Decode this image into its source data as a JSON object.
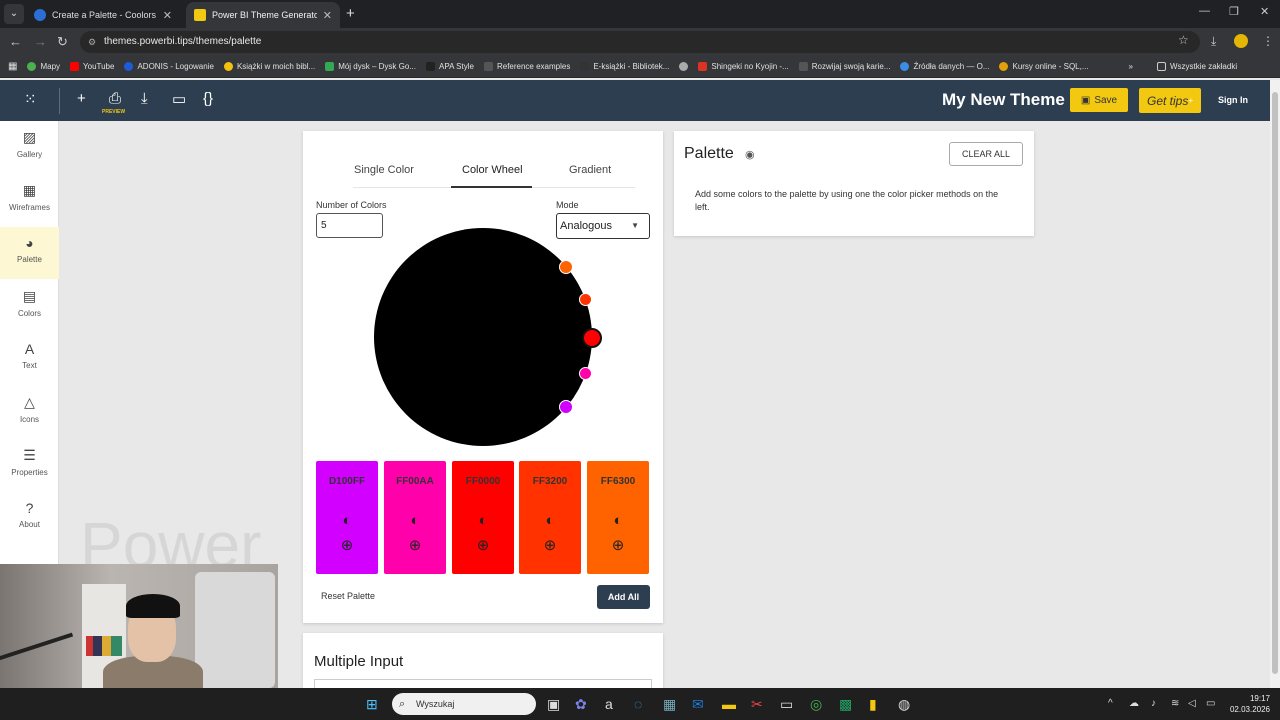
{
  "browser": {
    "tabs": [
      {
        "title": "Create a Palette - Coolors",
        "active": false
      },
      {
        "title": "Power BI Theme Generator",
        "active": true
      }
    ],
    "url": "themes.powerbi.tips/themes/palette",
    "bookmarks": [
      "Mapy",
      "YouTube",
      "ADONIS - Logowanie",
      "Książki w moich bibl...",
      "Mój dysk – Dysk Go...",
      "APA Style",
      "Reference examples",
      "E-książki - Bibliotek...",
      "",
      "Shingeki no Kyojin -...",
      "Rozwijaj swoją karie...",
      "Źródła danych — O...",
      "Kursy online - SQL,..."
    ],
    "bookmarks_folder": "Wszystkie zakładki"
  },
  "app": {
    "toolbar_preview": "PREVIEW",
    "theme_title": "My New Theme",
    "save_label": "Save",
    "gettips_label": "Get tips",
    "signin_label": "Sign In",
    "sidebar": [
      {
        "label": "Gallery",
        "icon": "gallery-icon"
      },
      {
        "label": "Wireframes",
        "icon": "wireframes-icon"
      },
      {
        "label": "Palette",
        "icon": "palette-icon",
        "active": true
      },
      {
        "label": "Colors",
        "icon": "paint-roller-icon"
      },
      {
        "label": "Text",
        "icon": "text-icon"
      },
      {
        "label": "Icons",
        "icon": "shapes-icon"
      },
      {
        "label": "Properties",
        "icon": "sliders-icon"
      },
      {
        "label": "About",
        "icon": "help-icon"
      }
    ],
    "watermark": "Power"
  },
  "picker": {
    "tabs": [
      "Single Color",
      "Color Wheel",
      "Gradient"
    ],
    "active_tab": "Color Wheel",
    "num_colors_label": "Number of Colors",
    "num_colors_value": "5",
    "mode_label": "Mode",
    "mode_value": "Analogous",
    "wheel_dots": [
      "#FF6300",
      "#FF3200",
      "#FF0000",
      "#FF00AA",
      "#D100FF"
    ],
    "swatches": [
      {
        "hex": "D100FF",
        "color": "#D100FF"
      },
      {
        "hex": "FF00AA",
        "color": "#FF00AA"
      },
      {
        "hex": "FF0000",
        "color": "#FF0000"
      },
      {
        "hex": "FF3200",
        "color": "#FF3200"
      },
      {
        "hex": "FF6300",
        "color": "#FF6300"
      }
    ],
    "reset_label": "Reset Palette",
    "addall_label": "Add All"
  },
  "multiple_input": {
    "heading": "Multiple Input"
  },
  "palette_panel": {
    "heading": "Palette",
    "clear_label": "CLEAR ALL",
    "description": "Add some colors to the palette by using one the color picker methods on the left."
  },
  "taskbar": {
    "search_placeholder": "Wyszukaj",
    "time": "19:17",
    "date": "02.03.2026"
  }
}
